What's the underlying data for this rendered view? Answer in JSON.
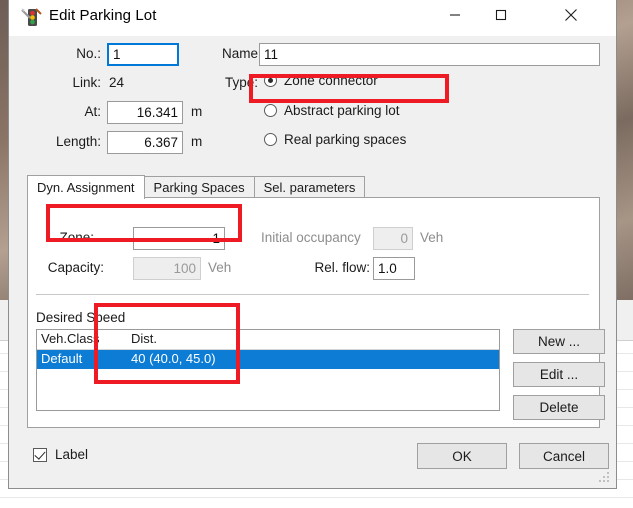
{
  "window": {
    "title": "Edit Parking Lot",
    "icon": "traffic-light-edit-icon",
    "controls": {
      "minimize": "minimize-icon",
      "maximize": "maximize-icon",
      "close": "close-icon"
    }
  },
  "form": {
    "no_label": "No.:",
    "no_value": "1",
    "link_label": "Link:",
    "link_value": "24",
    "at_label": "At:",
    "at_value": "16.341",
    "at_unit": "m",
    "length_label": "Length:",
    "length_value": "6.367",
    "length_unit": "m",
    "name_label": "Name:",
    "name_value": "11",
    "type_label": "Type:",
    "type_options": [
      {
        "label": "Zone connector",
        "selected": true
      },
      {
        "label": "Abstract parking lot",
        "selected": false
      },
      {
        "label": "Real parking spaces",
        "selected": false
      }
    ]
  },
  "tabs": [
    {
      "label": "Dyn. Assignment",
      "active": true
    },
    {
      "label": "Parking Spaces",
      "active": false
    },
    {
      "label": "Sel. parameters",
      "active": false
    }
  ],
  "dyn_assignment": {
    "zone_label": "Zone:",
    "zone_value": "1",
    "capacity_label": "Capacity:",
    "capacity_value": "100",
    "capacity_unit": "Veh",
    "initial_occupancy_label": "Initial occupancy",
    "initial_occupancy_value": "0",
    "initial_occupancy_unit": "Veh",
    "rel_flow_label": "Rel. flow:",
    "rel_flow_value": "1.0",
    "desired_speed_title": "Desired Speed",
    "columns": [
      "Veh.Class",
      "Dist."
    ],
    "rows": [
      {
        "veh_class": "Default",
        "dist": "40 (40.0, 45.0)",
        "selected": true
      }
    ],
    "buttons": {
      "new": "New ...",
      "edit": "Edit ...",
      "delete": "Delete"
    }
  },
  "footer": {
    "label_checkbox": "Label",
    "label_checked": true,
    "ok": "OK",
    "cancel": "Cancel"
  },
  "colors": {
    "accent_selection": "#0c7cd5",
    "focus_border": "#0078d7",
    "annotation": "#ee1b24",
    "dialog_bg": "#f0f0f0"
  }
}
